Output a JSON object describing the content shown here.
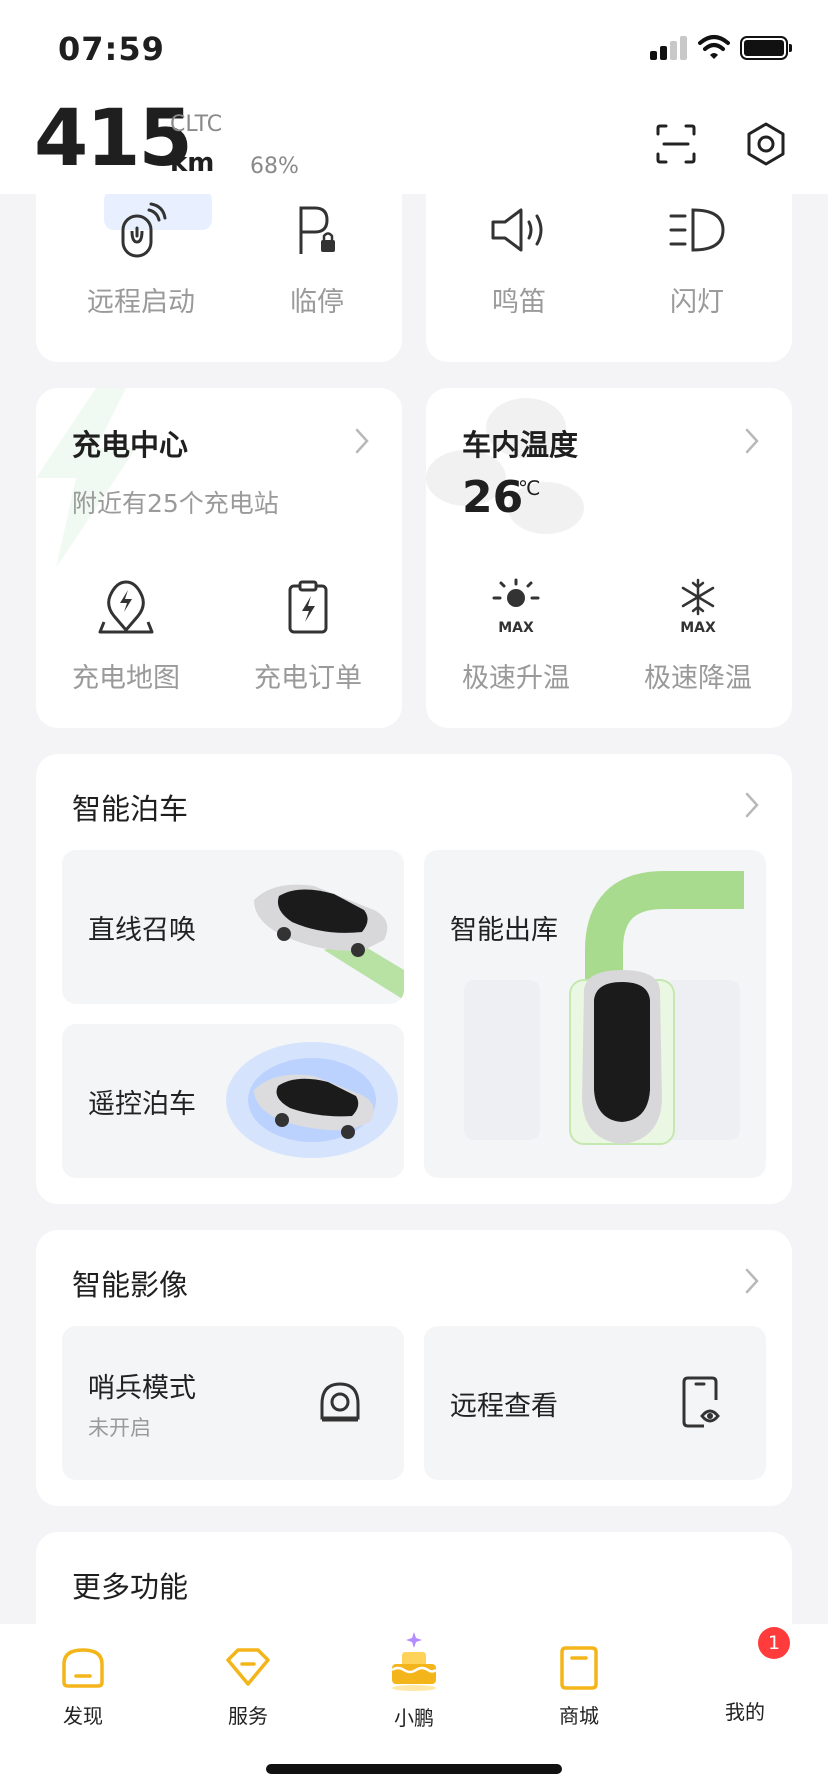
{
  "status_bar": {
    "time": "07:59"
  },
  "header": {
    "range": "415",
    "range_standard": "CLTC",
    "range_unit": "km",
    "battery_percent": "68%"
  },
  "quick_controls": [
    {
      "label": "远程启动",
      "icon": "remote-start-icon"
    },
    {
      "label": "临停",
      "icon": "parking-lock-icon"
    },
    {
      "label": "鸣笛",
      "icon": "horn-icon"
    },
    {
      "label": "闪灯",
      "icon": "headlight-icon"
    }
  ],
  "charging": {
    "title": "充电中心",
    "subtitle": "附近有25个充电站",
    "actions": [
      {
        "label": "充电地图"
      },
      {
        "label": "充电订单"
      }
    ]
  },
  "climate": {
    "title": "车内温度",
    "temperature": "26",
    "unit": "℃",
    "actions": [
      {
        "label": "极速升温",
        "badge": "MAX"
      },
      {
        "label": "极速降温",
        "badge": "MAX"
      }
    ]
  },
  "parking": {
    "title": "智能泊车",
    "items": [
      {
        "label": "直线召唤"
      },
      {
        "label": "遥控泊车"
      },
      {
        "label": "智能出库"
      }
    ]
  },
  "imaging": {
    "title": "智能影像",
    "items": [
      {
        "label": "哨兵模式",
        "status": "未开启"
      },
      {
        "label": "远程查看"
      }
    ]
  },
  "more": {
    "title": "更多功能"
  },
  "nav": {
    "items": [
      {
        "label": "发现"
      },
      {
        "label": "服务"
      },
      {
        "label": "小鹏"
      },
      {
        "label": "商城"
      },
      {
        "label": "我的"
      }
    ],
    "badge_count": "1"
  },
  "colors": {
    "accent_yellow": "#f3b51a",
    "badge_red": "#ff3b3b",
    "route_green": "#8fd16a",
    "remote_blue": "#c9dcff"
  }
}
